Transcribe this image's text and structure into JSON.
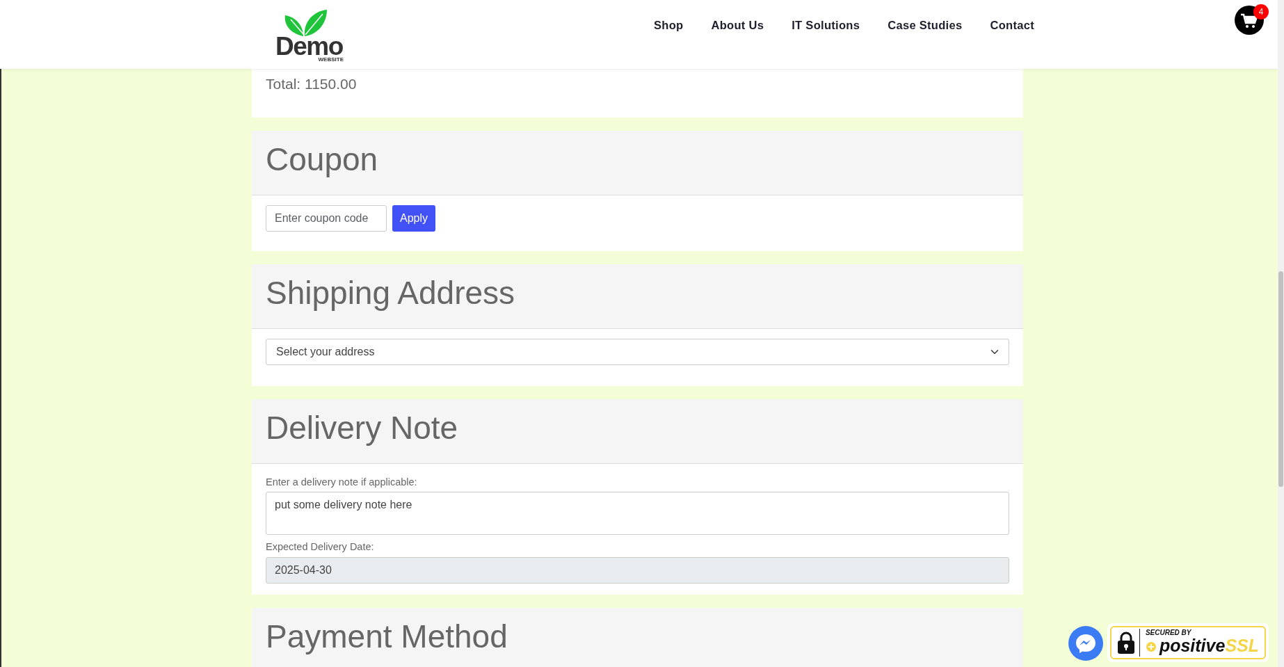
{
  "header": {
    "logo": {
      "name": "Demo",
      "tagline": "WEBSITE"
    },
    "nav": [
      {
        "label": "Shop"
      },
      {
        "label": "About Us"
      },
      {
        "label": "IT Solutions"
      },
      {
        "label": "Case Studies"
      },
      {
        "label": "Contact"
      }
    ],
    "cart": {
      "count": "4"
    }
  },
  "order_total": "Total: 1150.00",
  "sections": [
    {
      "kind": "coupon",
      "title": "Coupon",
      "placeholder": "Enter coupon code",
      "button": "Apply"
    },
    {
      "kind": "address",
      "title": "Shipping Address",
      "value": "Select your address"
    },
    {
      "kind": "delivery",
      "title": "Delivery Note",
      "note_label": "Enter a delivery note if applicable:",
      "note_value": "put some delivery note here",
      "date_label": "Expected Delivery Date:",
      "date_value": "2025-04-30",
      "date_disabled": true
    },
    {
      "kind": "payment",
      "title": "Payment Method"
    }
  ],
  "ssl_badge": {
    "line1": "SECURED BY",
    "brand": "positive",
    "brand_suffix": "SSL"
  }
}
